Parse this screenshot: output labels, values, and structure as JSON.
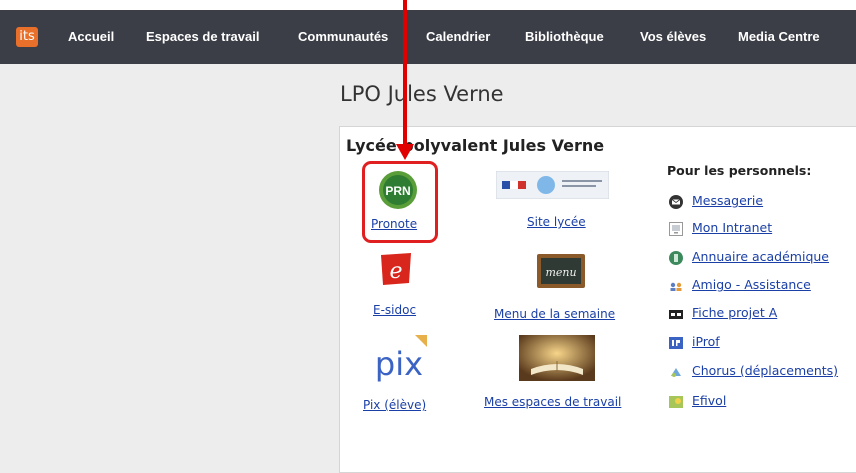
{
  "nav": {
    "logo": "its",
    "items": [
      "Accueil",
      "Espaces de travail",
      "Communautés",
      "Calendrier",
      "Bibliothèque",
      "Vos élèves",
      "Media Centre"
    ]
  },
  "page": {
    "title": "LPO Jules Verne"
  },
  "panel": {
    "title": "Lycée polyvalent Jules Verne",
    "apps": {
      "pronote": {
        "label": "Pronote",
        "icon_text": "PRN"
      },
      "site": {
        "label": "Site lycée"
      },
      "esidoc": {
        "label": "E-sidoc"
      },
      "menu": {
        "label": "Menu de la semaine",
        "icon_text": "menu"
      },
      "pix": {
        "label": "Pix (élève)",
        "icon_text": "pix"
      },
      "espaces": {
        "label": "Mes espaces de travail"
      }
    },
    "staff": {
      "heading": "Pour les personnels:",
      "links": [
        {
          "label": "Messagerie",
          "icon": "envelope-icon"
        },
        {
          "label": "Mon Intranet",
          "icon": "intranet-icon"
        },
        {
          "label": "Annuaire académique",
          "icon": "directory-icon"
        },
        {
          "label": "Amigo - Assistance",
          "icon": "people-icon"
        },
        {
          "label": "Fiche projet A",
          "icon": "ap-icon"
        },
        {
          "label": "iProf",
          "icon": "iprof-icon"
        },
        {
          "label": "Chorus (déplacements)",
          "icon": "chorus-icon"
        },
        {
          "label": "Efivol",
          "icon": "efivol-icon"
        }
      ]
    }
  },
  "colors": {
    "navbar": "#3b3e47",
    "link": "#1a3fa6",
    "highlight": "#e02020",
    "logo": "#e8702a"
  }
}
